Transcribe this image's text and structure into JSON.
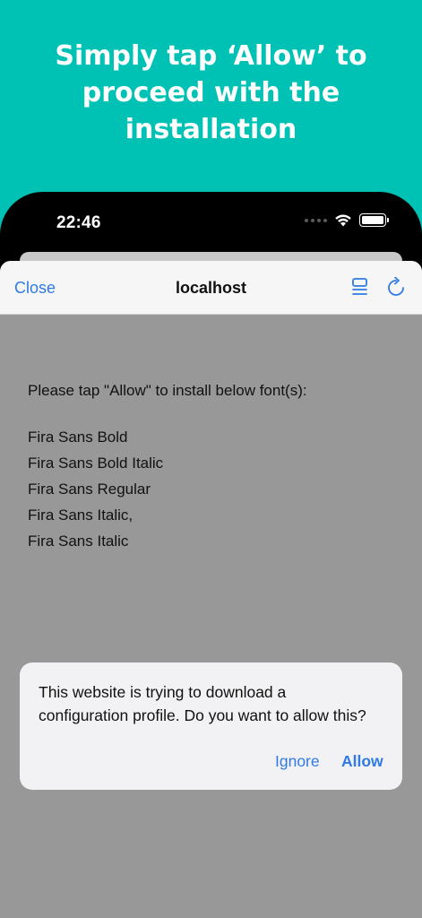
{
  "headline": {
    "line1": "Simply tap ‘Allow’ to",
    "line2": "proceed with the",
    "line3": "installation"
  },
  "status_bar": {
    "time": "22:46",
    "icons": [
      "cellular-signal-icon",
      "wifi-icon",
      "battery-icon"
    ]
  },
  "navbar": {
    "close_label": "Close",
    "title": "localhost",
    "icons": [
      "reader-icon",
      "reload-icon"
    ],
    "accent_color": "#2f7ae5"
  },
  "page": {
    "prompt": "Please tap \"Allow\" to install below font(s):",
    "fonts": [
      "Fira Sans Bold",
      "Fira Sans Bold Italic",
      "Fira Sans Regular",
      "Fira Sans Italic,",
      "Fira Sans Italic"
    ]
  },
  "dialog": {
    "message_line1": "This website is trying to download a",
    "message_line2": "configuration profile. Do you want to allow this?",
    "ignore_label": "Ignore",
    "allow_label": "Allow"
  },
  "colors": {
    "background": "#00c2b4",
    "sheet_dimmed": "#989898",
    "accent": "#2f7ae5"
  }
}
